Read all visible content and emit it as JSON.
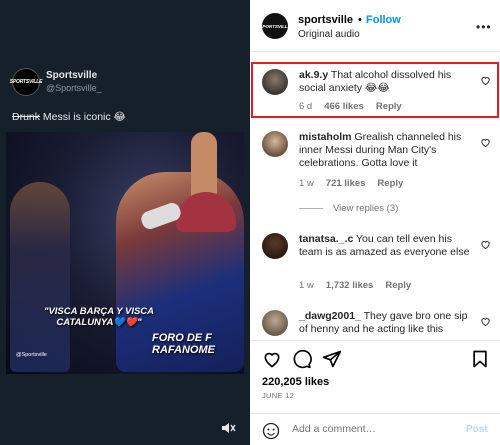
{
  "tweet": {
    "author_name": "Sportsville",
    "author_handle": "@Sportsville_",
    "text_strike": "Drunk",
    "text_rest": " Messi is iconic 😂",
    "avatar_text": "SPORTSVILLE"
  },
  "video": {
    "caption": "\"VISCA BARÇA Y VISCA CATALUNYA💙❤️\"",
    "overlay": "FORO DE F RAFANOME",
    "watermark": "@Sportsville",
    "mute_icon": "speaker-muted-icon"
  },
  "post_header": {
    "username": "sportsville",
    "separator": "•",
    "follow_label": "Follow",
    "audio": "Original audio",
    "more_icon": "more-horizontal-icon",
    "avatar_text": "SPORTSVILLE"
  },
  "comments": [
    {
      "user": "ak.9.y",
      "text": " That alcohol dissolved his social anxiety 😂😂",
      "time": "6 d",
      "likes": "466 likes",
      "reply": "Reply"
    },
    {
      "user": "mistaholm",
      "text": " Grealish channeled his inner Messi during Man City's celebrations. Gotta love it",
      "time": "1 w",
      "likes": "721 likes",
      "reply": "Reply"
    },
    {
      "user": "tanatsa._.c",
      "text": " You can tell even his team is as amazed as everyone else",
      "time": "1 w",
      "likes": "1,732 likes",
      "reply": "Reply"
    },
    {
      "user": "_dawg2001_",
      "text": " They gave bro one sip of henny and he acting like this",
      "time": "",
      "likes": "",
      "reply": ""
    }
  ],
  "view_replies": "View replies (3)",
  "actions": {
    "like_icon": "heart-icon",
    "comment_icon": "comment-icon",
    "share_icon": "send-icon",
    "save_icon": "bookmark-icon"
  },
  "likes": "220,205 likes",
  "date": "JUNE 12",
  "add_comment": {
    "placeholder": "Add a comment…",
    "post_label": "Post",
    "emoji_icon": "emoji-icon"
  },
  "colors": {
    "follow": "#0095f6",
    "highlight": "#e02020",
    "post_disabled": "#b3dbff"
  }
}
